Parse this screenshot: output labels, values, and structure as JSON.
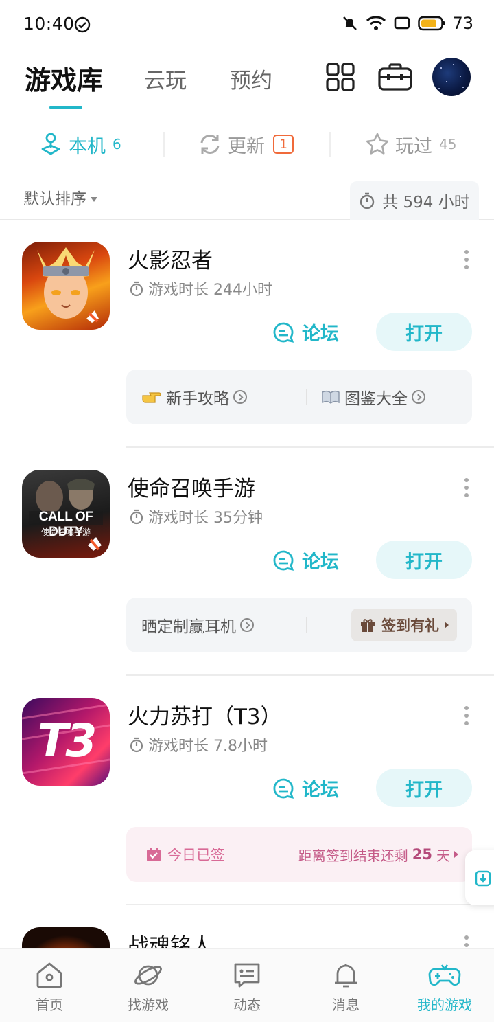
{
  "status_bar": {
    "time": "10:40",
    "battery": "73"
  },
  "header": {
    "tabs": [
      {
        "label": "游戏库"
      },
      {
        "label": "云玩"
      },
      {
        "label": "预约"
      }
    ]
  },
  "filters": {
    "local": {
      "label": "本机",
      "count": "6"
    },
    "update": {
      "label": "更新",
      "badge": "1"
    },
    "played": {
      "label": "玩过",
      "count": "45"
    }
  },
  "sort": {
    "label": "默认排序",
    "total": "共 594 小时"
  },
  "games": [
    {
      "title": "火影忍者",
      "time": "游戏时长 244小时",
      "forum": "论坛",
      "open": "打开",
      "links": [
        "新手攻略",
        "图鉴大全"
      ]
    },
    {
      "title": "使命召唤手游",
      "time": "游戏时长 35分钟",
      "forum": "论坛",
      "open": "打开",
      "link": "晒定制赢耳机",
      "gift": "签到有礼"
    },
    {
      "title": "火力苏打（T3）",
      "time": "游戏时长 7.8小时",
      "forum": "论坛",
      "open": "打开",
      "signed": "今日已签",
      "remain_prefix": "距离签到结束还剩",
      "remain_days": "25",
      "remain_suffix": "天"
    },
    {
      "title": "战魂铭人"
    }
  ],
  "icon_text": {
    "cod_line1": "CALL OF DUTY",
    "cod_line2": "使命召唤手游",
    "t3": "T3"
  },
  "bottom_nav": [
    {
      "label": "首页"
    },
    {
      "label": "找游戏"
    },
    {
      "label": "动态"
    },
    {
      "label": "消息"
    },
    {
      "label": "我的游戏"
    }
  ],
  "colors": {
    "accent": "#22b7c9",
    "badge": "#f06a3a",
    "signed": "#d86a96"
  }
}
